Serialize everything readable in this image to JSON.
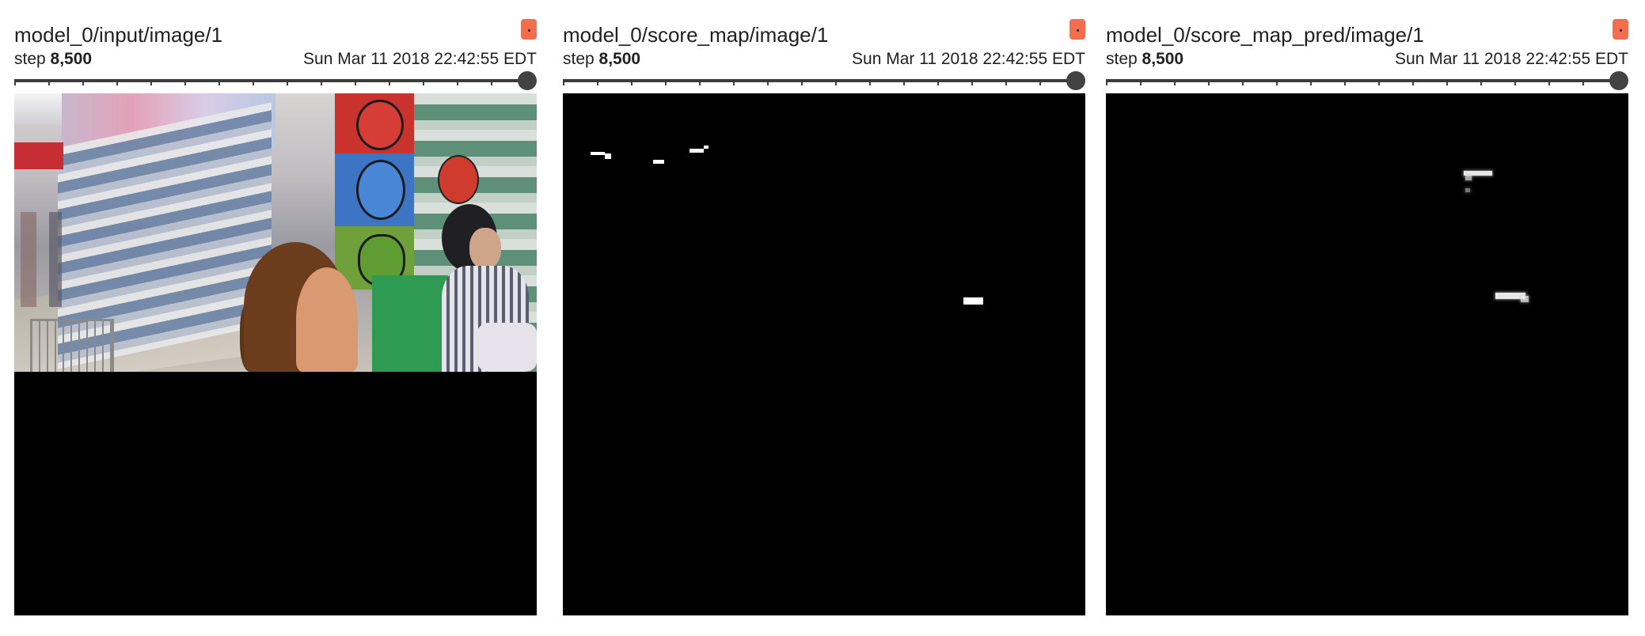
{
  "cards": [
    {
      "title": "model_0/input/image/1",
      "step_label": "step",
      "step_value": "8,500",
      "timestamp": "Sun Mar 11 2018 22:42:55 EDT",
      "slider_position": 1.0
    },
    {
      "title": "model_0/score_map/image/1",
      "step_label": "step",
      "step_value": "8,500",
      "timestamp": "Sun Mar 11 2018 22:42:55 EDT",
      "slider_position": 1.0
    },
    {
      "title": "model_0/score_map_pred/image/1",
      "step_label": "step",
      "step_value": "8,500",
      "timestamp": "Sun Mar 11 2018 22:42:55 EDT",
      "slider_position": 1.0
    }
  ],
  "colors": {
    "accent_icon": "#f26e4f",
    "slider": "#424242",
    "image_background": "#000000"
  },
  "icons": {
    "expand": "expand-image-icon"
  }
}
